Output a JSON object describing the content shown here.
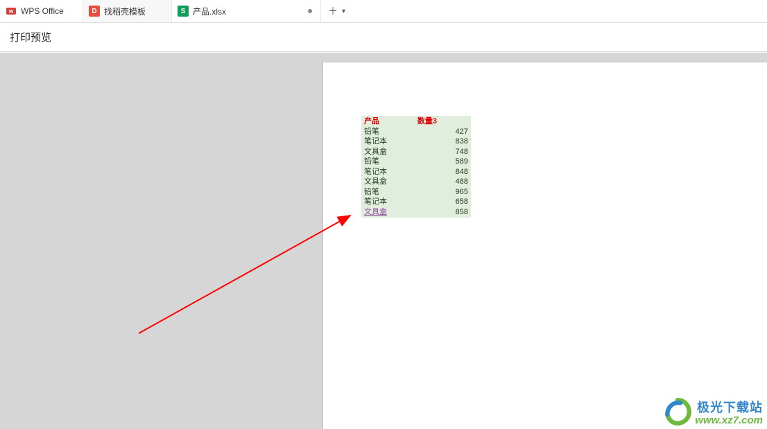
{
  "tabs": {
    "t0": {
      "label": "WPS Office"
    },
    "t1": {
      "label": "找稻壳模板"
    },
    "t2": {
      "label": "产品.xlsx"
    }
  },
  "toolbar": {
    "title": "打印预览"
  },
  "table": {
    "header": {
      "col1": "产品",
      "col2": "数量3"
    },
    "rows": [
      {
        "name": "铅笔",
        "qty": "427"
      },
      {
        "name": "笔记本",
        "qty": "838"
      },
      {
        "name": "文具盒",
        "qty": "748"
      },
      {
        "name": "铅笔",
        "qty": "589"
      },
      {
        "name": "笔记本",
        "qty": "848"
      },
      {
        "name": "文具盒",
        "qty": "488"
      },
      {
        "name": "铅笔",
        "qty": "965"
      },
      {
        "name": "笔记本",
        "qty": "658"
      },
      {
        "name": "文具盒",
        "qty": "858"
      }
    ]
  },
  "watermark": {
    "line1": "极光下载站",
    "line2": "www.xz7.com"
  }
}
